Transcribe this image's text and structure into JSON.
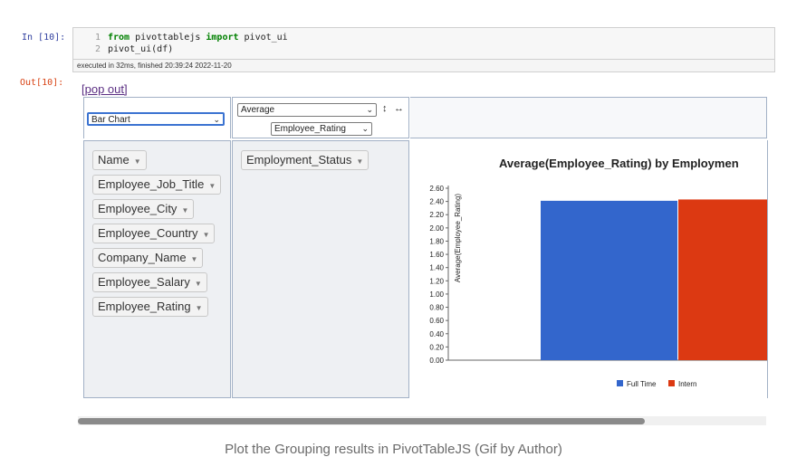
{
  "notebook": {
    "in_prompt": "In [10]:",
    "out_prompt": "Out[10]:",
    "code_lines": [
      {
        "num": "1",
        "kw1": "from",
        "mod": " pivottablejs ",
        "kw2": "import",
        "rest": " pivot_ui"
      },
      {
        "num": "2",
        "text": "pivot_ui(df)"
      }
    ],
    "exec_info": "executed in 32ms, finished 20:39:24 2022-11-20",
    "popout_link": "[pop out]"
  },
  "pivot": {
    "renderer": "Bar Chart",
    "aggregator": "Average",
    "agg_attribute": "Employee_Rating",
    "sort_icon": "↕",
    "swap_icon": "↔",
    "unused_attrs": [
      "Name",
      "Employee_Job_Title",
      "Employee_City",
      "Employee_Country",
      "Company_Name",
      "Employee_Salary",
      "Employee_Rating"
    ],
    "col_attrs": [
      "Employment_Status"
    ]
  },
  "chart_data": {
    "type": "bar",
    "title": "Average(Employee_Rating) by Employmen",
    "ylabel": "Average(Employee_Rating)",
    "ylim": [
      0,
      2.6
    ],
    "yticks": [
      "0.00",
      "0.20",
      "0.40",
      "0.60",
      "0.80",
      "1.00",
      "1.20",
      "1.40",
      "1.60",
      "1.80",
      "2.00",
      "2.20",
      "2.40",
      "2.60"
    ],
    "categories": [
      "Full Time",
      "Intern"
    ],
    "series": [
      {
        "name": "Full Time",
        "values": [
          2.41
        ],
        "color": "#3366cc"
      },
      {
        "name": "Intern",
        "values": [
          2.43
        ],
        "color": "#dc3912"
      }
    ],
    "legend": [
      "Full Time",
      "Intern"
    ]
  },
  "caption": "Plot the Grouping results in PivotTableJS (Gif by Author)"
}
